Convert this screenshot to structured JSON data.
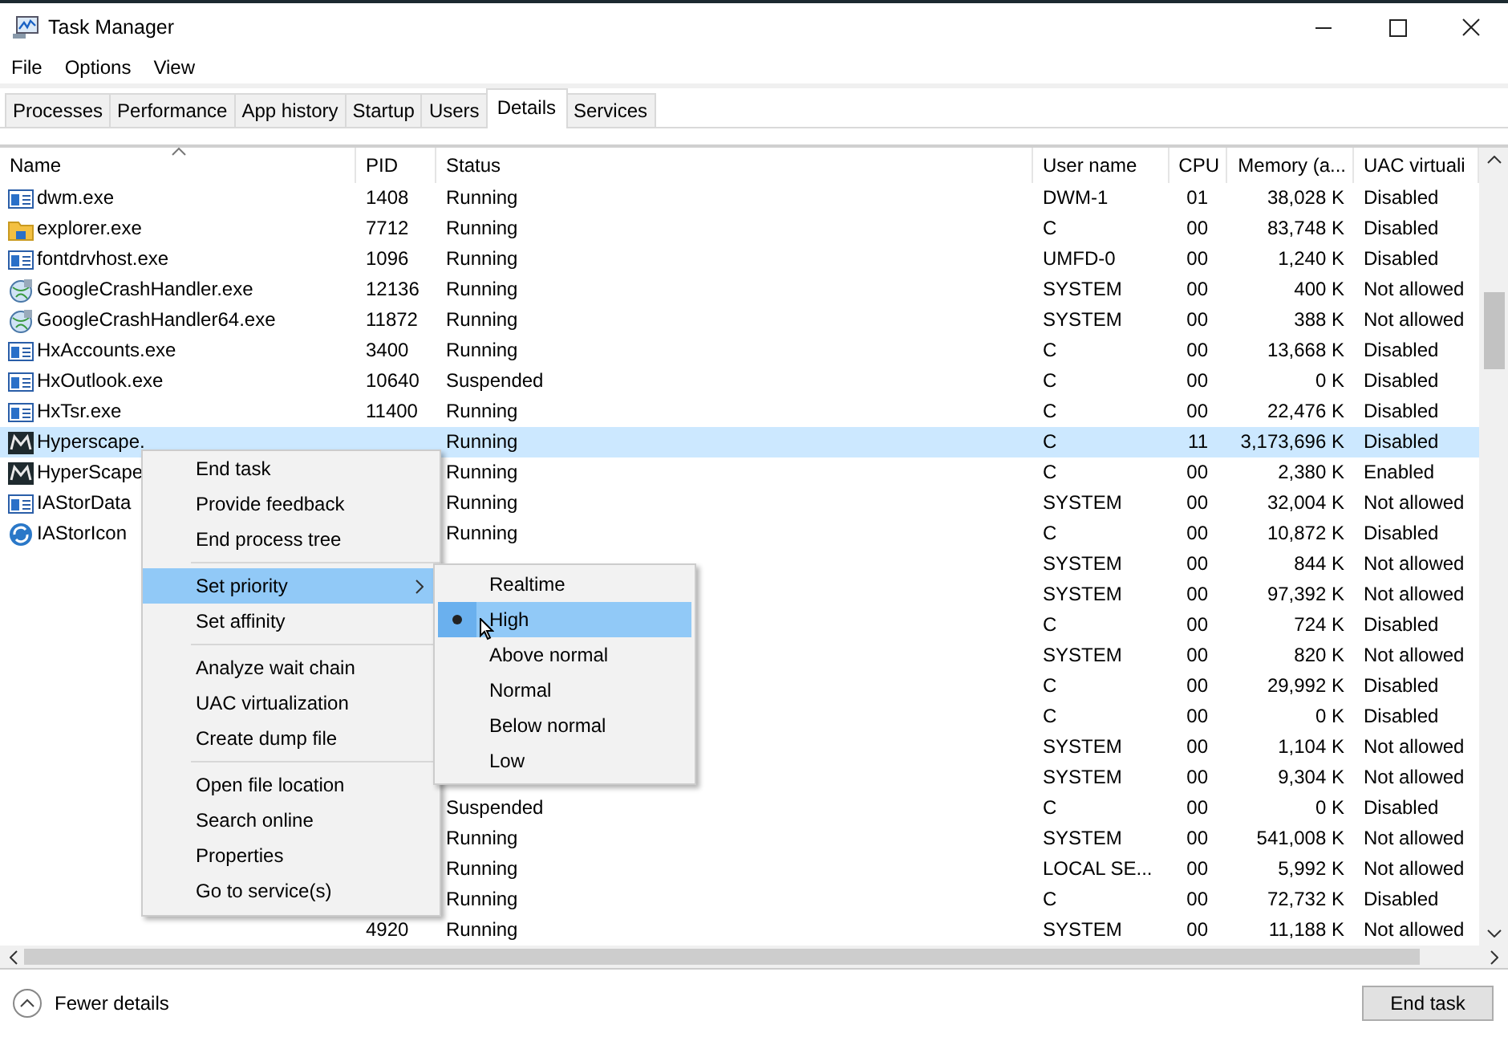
{
  "window": {
    "title": "Task Manager"
  },
  "menu_bar": [
    {
      "label": "File"
    },
    {
      "label": "Options"
    },
    {
      "label": "View"
    }
  ],
  "tabs": [
    {
      "label": "Processes",
      "selected": false
    },
    {
      "label": "Performance",
      "selected": false
    },
    {
      "label": "App history",
      "selected": false
    },
    {
      "label": "Startup",
      "selected": false
    },
    {
      "label": "Users",
      "selected": false
    },
    {
      "label": "Details",
      "selected": true
    },
    {
      "label": "Services",
      "selected": false
    }
  ],
  "table": {
    "columns": [
      {
        "label": "Name",
        "sorted": true
      },
      {
        "label": "PID",
        "sorted": false
      },
      {
        "label": "Status",
        "sorted": false
      },
      {
        "label": "User name",
        "sorted": false
      },
      {
        "label": "CPU",
        "sorted": false
      },
      {
        "label": "Memory (a...",
        "sorted": false
      },
      {
        "label": "UAC virtuali",
        "sorted": false
      }
    ],
    "rows": [
      {
        "kind": "app",
        "name": "dwm.exe",
        "pid": "1408",
        "status": "Running",
        "user": "DWM-1",
        "cpu": "01",
        "memory": "38,028 K",
        "uac": "Disabled",
        "selected": false
      },
      {
        "kind": "folder",
        "name": "explorer.exe",
        "pid": "7712",
        "status": "Running",
        "user": "C",
        "cpu": "00",
        "memory": "83,748 K",
        "uac": "Disabled",
        "selected": false
      },
      {
        "kind": "app",
        "name": "fontdrvhost.exe",
        "pid": "1096",
        "status": "Running",
        "user": "UMFD-0",
        "cpu": "00",
        "memory": "1,240 K",
        "uac": "Disabled",
        "selected": false
      },
      {
        "kind": "globe",
        "name": "GoogleCrashHandler.exe",
        "pid": "12136",
        "status": "Running",
        "user": "SYSTEM",
        "cpu": "00",
        "memory": "400 K",
        "uac": "Not allowed",
        "selected": false
      },
      {
        "kind": "globe",
        "name": "GoogleCrashHandler64.exe",
        "pid": "11872",
        "status": "Running",
        "user": "SYSTEM",
        "cpu": "00",
        "memory": "388 K",
        "uac": "Not allowed",
        "selected": false
      },
      {
        "kind": "app",
        "name": "HxAccounts.exe",
        "pid": "3400",
        "status": "Running",
        "user": "C",
        "cpu": "00",
        "memory": "13,668 K",
        "uac": "Disabled",
        "selected": false
      },
      {
        "kind": "app",
        "name": "HxOutlook.exe",
        "pid": "10640",
        "status": "Suspended",
        "user": "C",
        "cpu": "00",
        "memory": "0 K",
        "uac": "Disabled",
        "selected": false
      },
      {
        "kind": "app",
        "name": "HxTsr.exe",
        "pid": "11400",
        "status": "Running",
        "user": "C",
        "cpu": "00",
        "memory": "22,476 K",
        "uac": "Disabled",
        "selected": false
      },
      {
        "kind": "game",
        "name": "Hyperscape.",
        "status": "Running",
        "user": "C",
        "cpu": "11",
        "memory": "3,173,696 K",
        "uac": "Disabled",
        "selected": true
      },
      {
        "kind": "game",
        "name": "HyperScape",
        "status": "Running",
        "user": "C",
        "cpu": "00",
        "memory": "2,380 K",
        "uac": "Enabled",
        "selected": false
      },
      {
        "kind": "app",
        "name": "IAStorData",
        "status": "Running",
        "user": "SYSTEM",
        "cpu": "00",
        "memory": "32,004 K",
        "uac": "Not allowed",
        "selected": false
      },
      {
        "kind": "sync",
        "name": "IAStorIcon",
        "status": "Running",
        "user": "C",
        "cpu": "00",
        "memory": "10,872 K",
        "uac": "Disabled",
        "selected": false
      },
      {
        "user": "SYSTEM",
        "cpu": "00",
        "memory": "844 K",
        "uac": "Not allowed",
        "selected": false
      },
      {
        "user": "SYSTEM",
        "cpu": "00",
        "memory": "97,392 K",
        "uac": "Not allowed",
        "selected": false
      },
      {
        "user": "C",
        "cpu": "00",
        "memory": "724 K",
        "uac": "Disabled",
        "selected": false
      },
      {
        "user": "SYSTEM",
        "cpu": "00",
        "memory": "820 K",
        "uac": "Not allowed",
        "selected": false
      },
      {
        "user": "C",
        "cpu": "00",
        "memory": "29,992 K",
        "uac": "Disabled",
        "selected": false
      },
      {
        "user": "C",
        "cpu": "00",
        "memory": "0 K",
        "uac": "Disabled",
        "selected": false
      },
      {
        "user": "SYSTEM",
        "cpu": "00",
        "memory": "1,104 K",
        "uac": "Not allowed",
        "selected": false
      },
      {
        "user": "SYSTEM",
        "cpu": "00",
        "memory": "9,304 K",
        "uac": "Not allowed",
        "selected": false
      },
      {
        "status": "Suspended",
        "user": "C",
        "cpu": "00",
        "memory": "0 K",
        "uac": "Disabled",
        "selected": false
      },
      {
        "status": "Running",
        "user": "SYSTEM",
        "cpu": "00",
        "memory": "541,008 K",
        "uac": "Not allowed",
        "selected": false
      },
      {
        "status": "Running",
        "user": "LOCAL SE...",
        "cpu": "00",
        "memory": "5,992 K",
        "uac": "Not allowed",
        "selected": false
      },
      {
        "status": "Running",
        "user": "C",
        "cpu": "00",
        "memory": "72,732 K",
        "uac": "Disabled",
        "selected": false
      },
      {
        "pid": "4920",
        "status": "Running",
        "user": "SYSTEM",
        "cpu": "00",
        "memory": "11,188 K",
        "uac": "Not allowed",
        "selected": false
      }
    ]
  },
  "context_menu": {
    "groups": [
      [
        {
          "label": "End task",
          "selected": false,
          "submenu": false
        },
        {
          "label": "Provide feedback",
          "selected": false,
          "submenu": false
        },
        {
          "label": "End process tree",
          "selected": false,
          "submenu": false
        }
      ],
      [
        {
          "label": "Set priority",
          "selected": true,
          "submenu": true
        },
        {
          "label": "Set affinity",
          "selected": false,
          "submenu": false
        }
      ],
      [
        {
          "label": "Analyze wait chain",
          "selected": false,
          "submenu": false
        },
        {
          "label": "UAC virtualization",
          "selected": false,
          "submenu": false
        },
        {
          "label": "Create dump file",
          "selected": false,
          "submenu": false
        }
      ],
      [
        {
          "label": "Open file location",
          "selected": false,
          "submenu": false
        },
        {
          "label": "Search online",
          "selected": false,
          "submenu": false
        },
        {
          "label": "Properties",
          "selected": false,
          "submenu": false
        },
        {
          "label": "Go to service(s)",
          "selected": false,
          "submenu": false
        }
      ]
    ]
  },
  "priority_submenu": [
    {
      "label": "Realtime",
      "selected": false,
      "checked": false
    },
    {
      "label": "High",
      "selected": true,
      "checked": true
    },
    {
      "label": "Above normal",
      "selected": false,
      "checked": false
    },
    {
      "label": "Normal",
      "selected": false,
      "checked": false
    },
    {
      "label": "Below normal",
      "selected": false,
      "checked": false
    },
    {
      "label": "Low",
      "selected": false,
      "checked": false
    }
  ],
  "footer": {
    "details_toggle": "Fewer details",
    "end_task_button": "End task"
  }
}
